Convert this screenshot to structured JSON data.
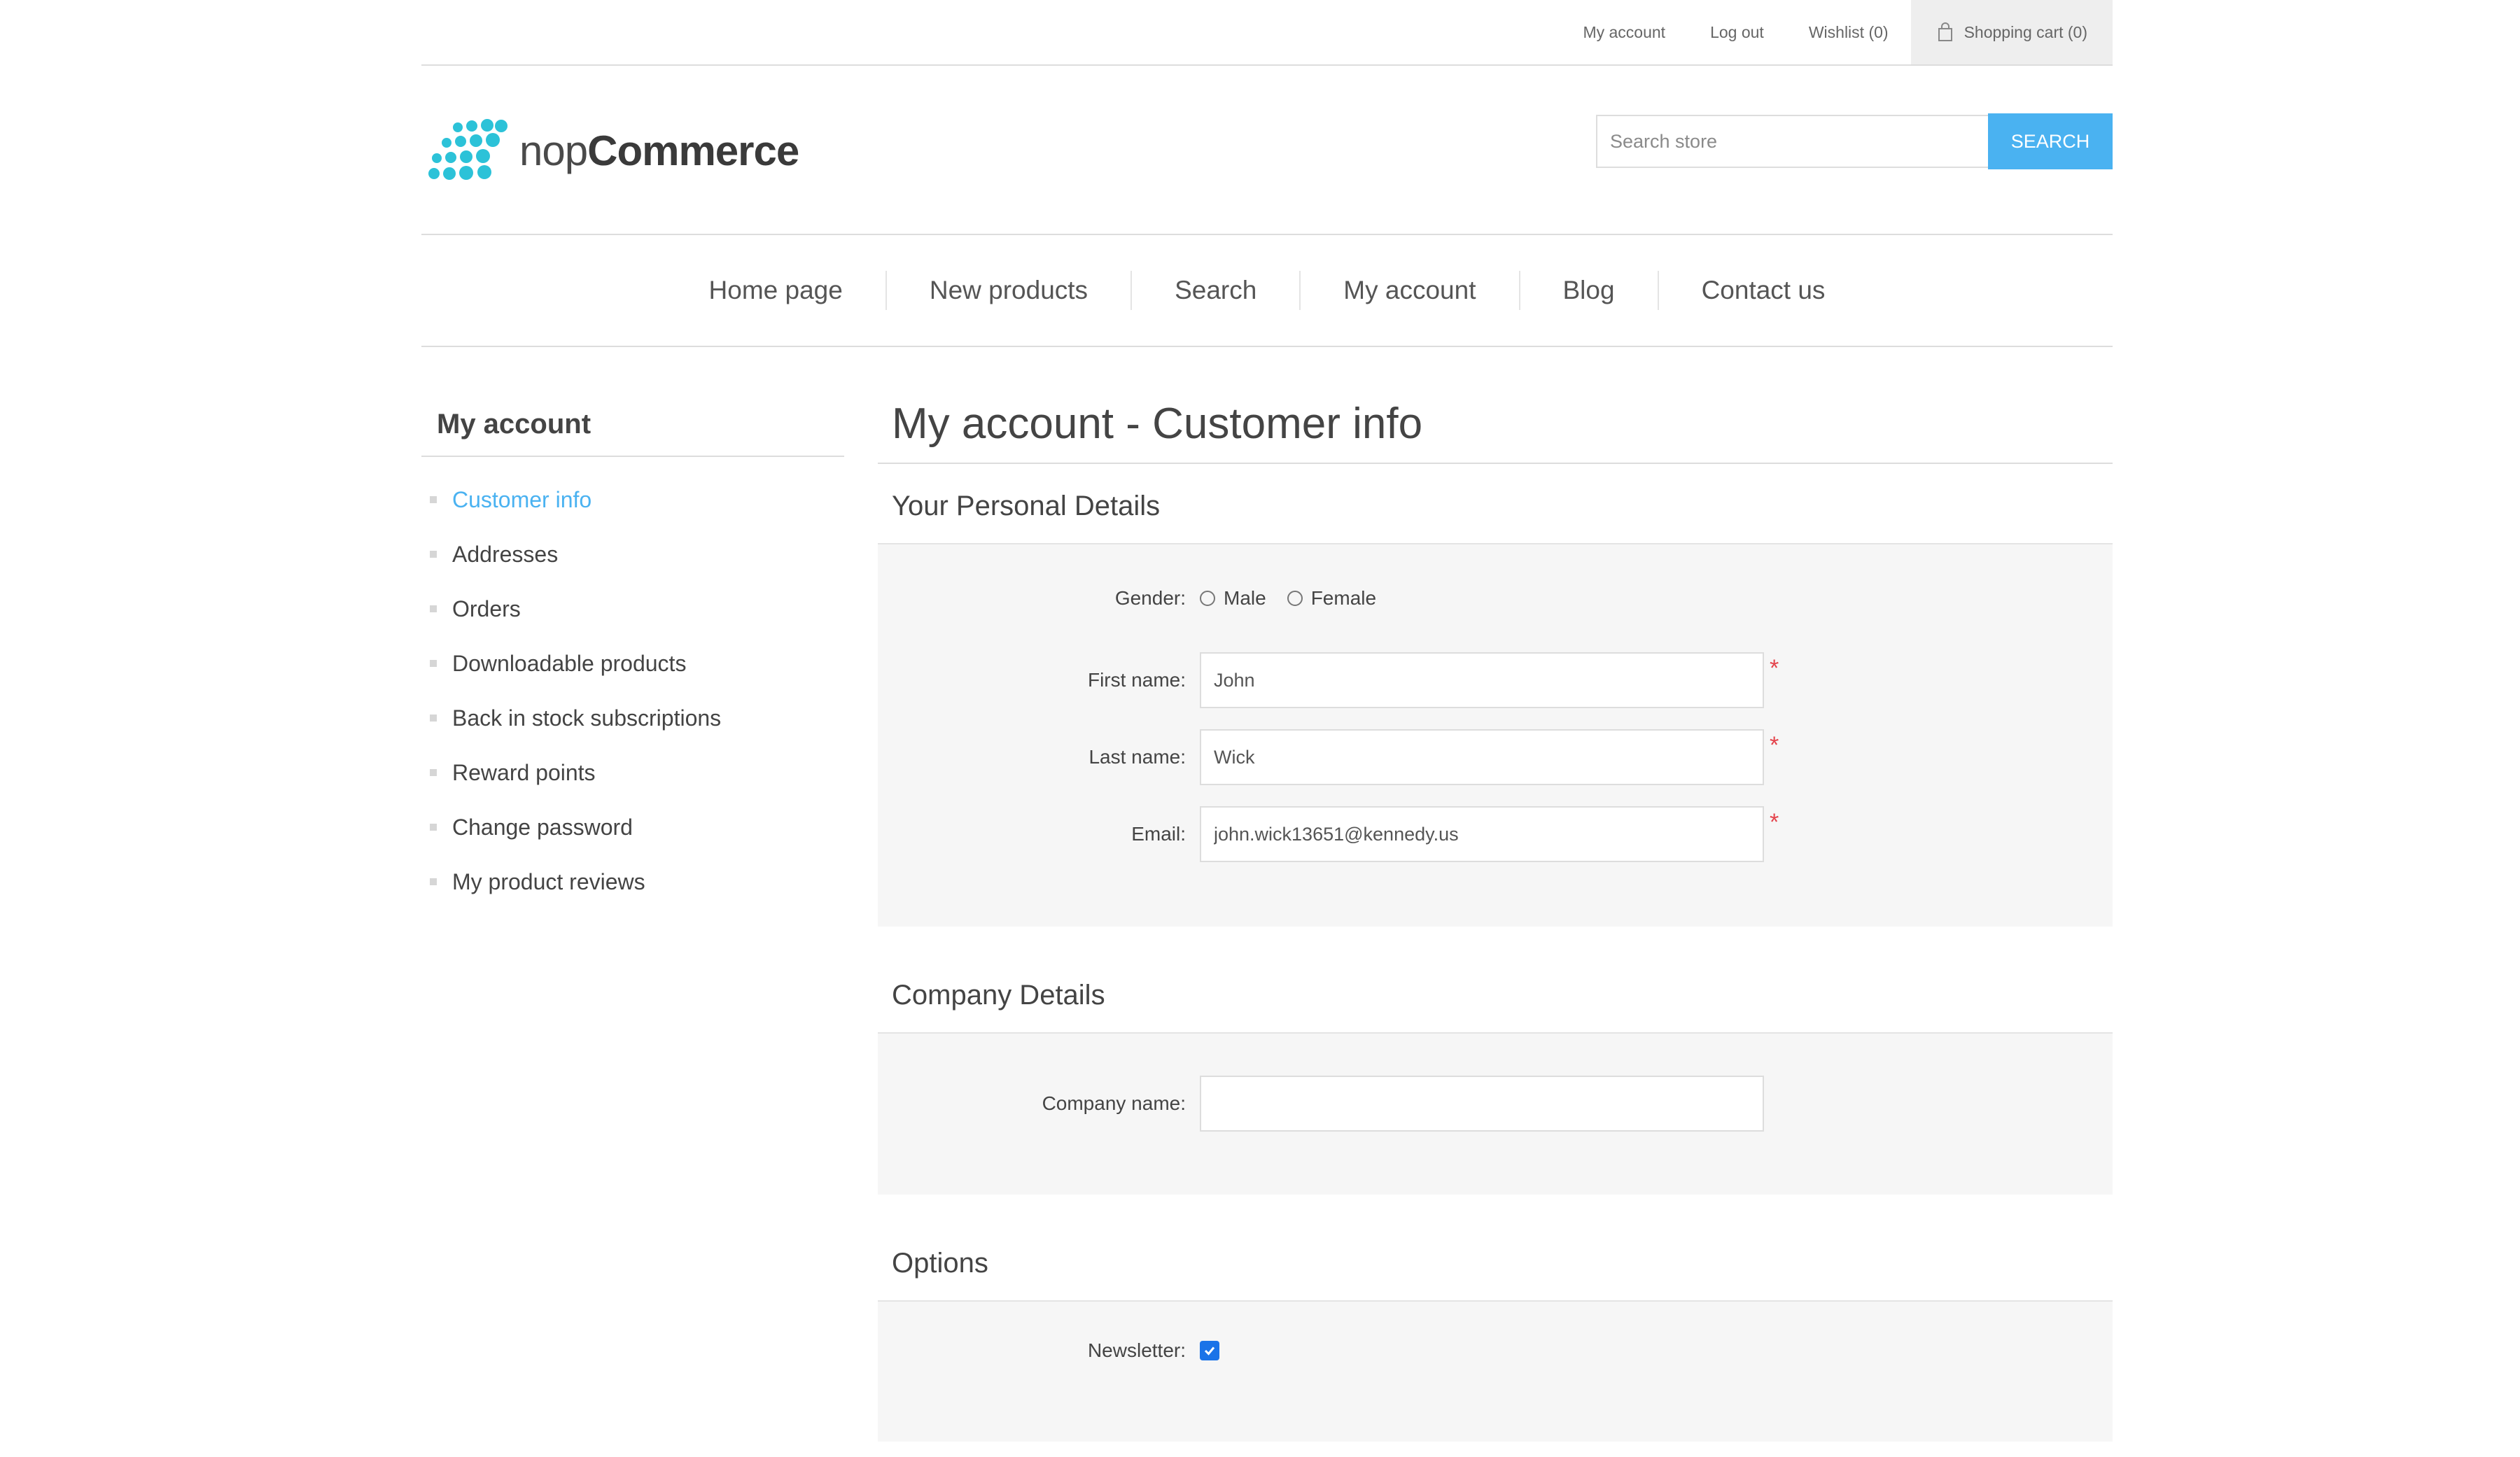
{
  "header_links": {
    "my_account": "My account",
    "log_out": "Log out",
    "wishlist": "Wishlist (0)",
    "shopping_cart": "Shopping cart (0)"
  },
  "logo": {
    "text_light": "nop",
    "text_bold": "Commerce",
    "dot_color": "#2cc2d8"
  },
  "search": {
    "placeholder": "Search store",
    "button_label": "SEARCH"
  },
  "menu": {
    "items": [
      "Home page",
      "New products",
      "Search",
      "My account",
      "Blog",
      "Contact us"
    ]
  },
  "side_nav": {
    "title": "My account",
    "items": [
      "Customer info",
      "Addresses",
      "Orders",
      "Downloadable products",
      "Back in stock subscriptions",
      "Reward points",
      "Change password",
      "My product reviews"
    ],
    "active_index": 0
  },
  "main": {
    "page_title": "My account - Customer info",
    "personal": {
      "title": "Your Personal Details",
      "gender_label": "Gender:",
      "male_label": "Male",
      "female_label": "Female",
      "first_name_label": "First name:",
      "first_name_value": "John",
      "last_name_label": "Last name:",
      "last_name_value": "Wick",
      "email_label": "Email:",
      "email_value": "john.wick13651@kennedy.us",
      "required_mark": "*"
    },
    "company": {
      "title": "Company Details",
      "company_name_label": "Company name:",
      "company_name_value": ""
    },
    "options": {
      "title": "Options",
      "newsletter_label": "Newsletter:",
      "newsletter_checked": true
    }
  },
  "colors": {
    "accent": "#4ab2f1",
    "required": "#e4444c",
    "panel_bg": "#f6f6f6",
    "checkbox": "#1a73e8"
  }
}
